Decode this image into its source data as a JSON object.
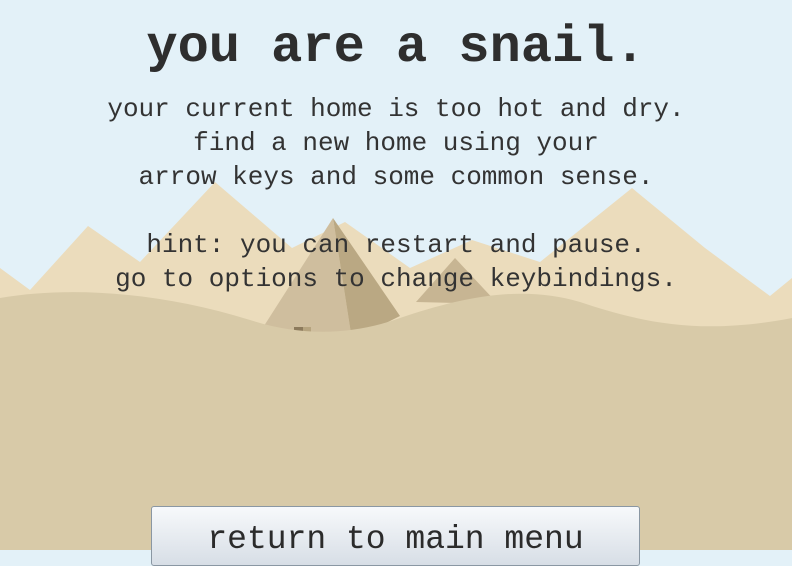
{
  "title": "you are a snail.",
  "intro": {
    "lines": [
      "your current home is too hot and dry.",
      "find a new home using your",
      "arrow keys and some common sense."
    ]
  },
  "hint": {
    "lines": [
      "hint: you can restart and pause.",
      "go to options to change keybindings."
    ]
  },
  "menu_button": {
    "label": "return to main menu"
  },
  "colors": {
    "sky": "#e3f1f8",
    "far_dunes": "#ebdcbc",
    "near_sand": "#d8caa8",
    "pyramid_light": "#c9b796",
    "pyramid_shade": "#b9a682",
    "text": "#333333"
  }
}
